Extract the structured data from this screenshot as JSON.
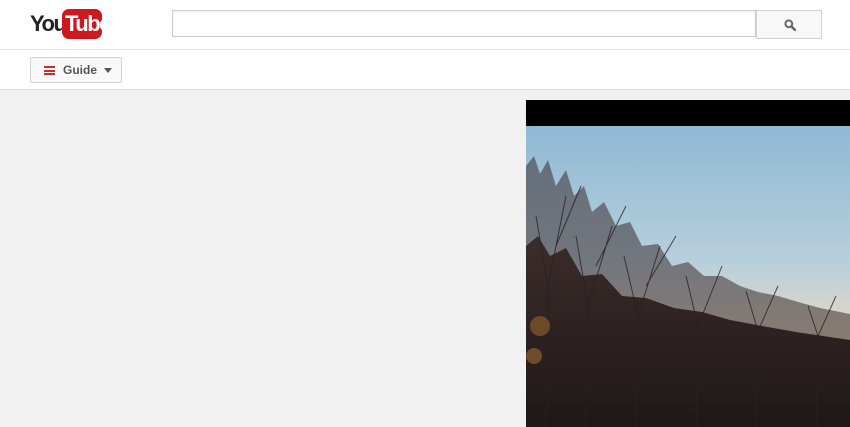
{
  "masthead": {
    "logo": {
      "part1": "You",
      "part2": "Tube",
      "brand_color": "#cc181e"
    },
    "search": {
      "value": "",
      "placeholder": "",
      "button_icon": "search-icon"
    }
  },
  "guidebar": {
    "guide_button": {
      "label": "Guide",
      "icon": "hamburger-icon",
      "caret": "caret-down-icon",
      "icon_color": "#c4302b"
    }
  },
  "main": {
    "video": {
      "thumbnail": "sunset-trees-image"
    }
  }
}
